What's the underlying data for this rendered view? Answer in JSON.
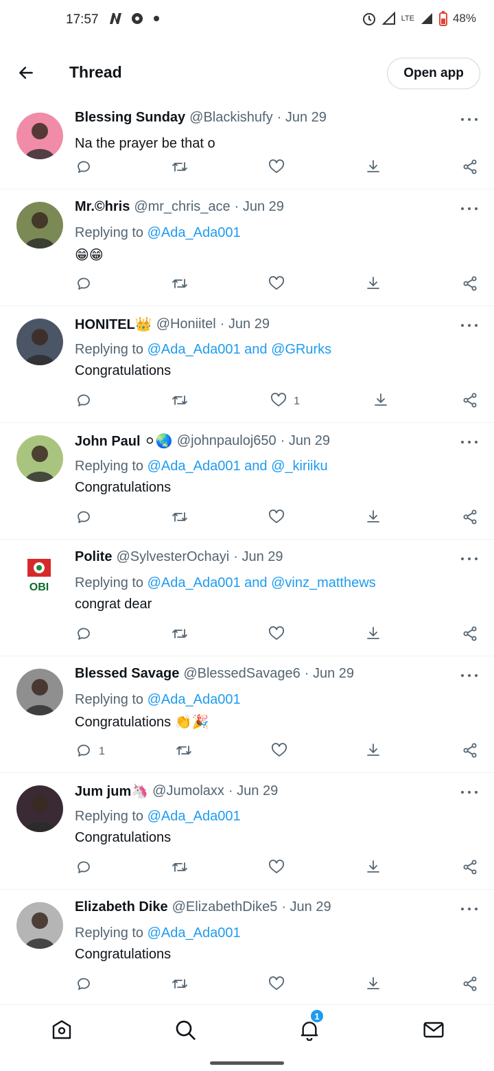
{
  "status_bar": {
    "time": "17:57",
    "network": "LTE",
    "battery": "48%"
  },
  "header": {
    "title": "Thread",
    "open_app_label": "Open app"
  },
  "reply_prefix": "Replying to",
  "tweets": [
    {
      "name": "Blessing Sunday",
      "handle": "@Blackishufy",
      "date": "· Jun 29",
      "replying_to": "",
      "text": "Na the prayer be that o",
      "replies": "",
      "likes": "",
      "avatar_color": "#f08ca8"
    },
    {
      "name": "Mr.©hris",
      "handle": "@mr_chris_ace",
      "date": "· Jun 29",
      "replying_to": "@Ada_Ada001",
      "text": "😁😁",
      "replies": "",
      "likes": "",
      "avatar_color": "#7b8a55"
    },
    {
      "name": "HONITEL👑",
      "handle": "@Honiitel",
      "date": "· Jun 29",
      "replying_to": "@Ada_Ada001 and @GRurks",
      "text": "Congratulations",
      "replies": "",
      "likes": "1",
      "avatar_color": "#4a5566"
    },
    {
      "name": "John Paul ⚪🌏",
      "handle": "@johnpauloj650",
      "date": "· Jun 29",
      "replying_to": "@Ada_Ada001 and @_kiriiku",
      "text": "Congratulations",
      "replies": "",
      "likes": "",
      "avatar_color": "#a9c47f"
    },
    {
      "name": "Polite",
      "handle": "@SylvesterOchayi",
      "date": "· Jun 29",
      "replying_to": "@Ada_Ada001 and @vinz_matthews",
      "text": "congrat dear",
      "replies": "",
      "likes": "",
      "avatar_color": "#ffffff"
    },
    {
      "name": "Blessed Savage",
      "handle": "@BlessedSavage6",
      "date": "· Jun 29",
      "replying_to": "@Ada_Ada001",
      "text": "Congratulations 👏🎉",
      "replies": "1",
      "likes": "",
      "avatar_color": "#8f8f8f"
    },
    {
      "name": "Jum jum🦄",
      "handle": "@Jumolaxx",
      "date": "· Jun 29",
      "replying_to": "@Ada_Ada001",
      "text": "Congratulations",
      "replies": "",
      "likes": "",
      "avatar_color": "#3a2a33"
    },
    {
      "name": "Elizabeth Dike",
      "handle": "@ElizabethDike5",
      "date": "· Jun 29",
      "replying_to": "@Ada_Ada001",
      "text": "Congratulations",
      "replies": "",
      "likes": "",
      "avatar_color": "#b5b5b5"
    }
  ],
  "polite_avatar_text": "OBI",
  "bottom_nav": {
    "notifications_badge": "1"
  },
  "colors": {
    "accent": "#1d9bf0",
    "text": "#0f1419",
    "muted": "#536471"
  }
}
